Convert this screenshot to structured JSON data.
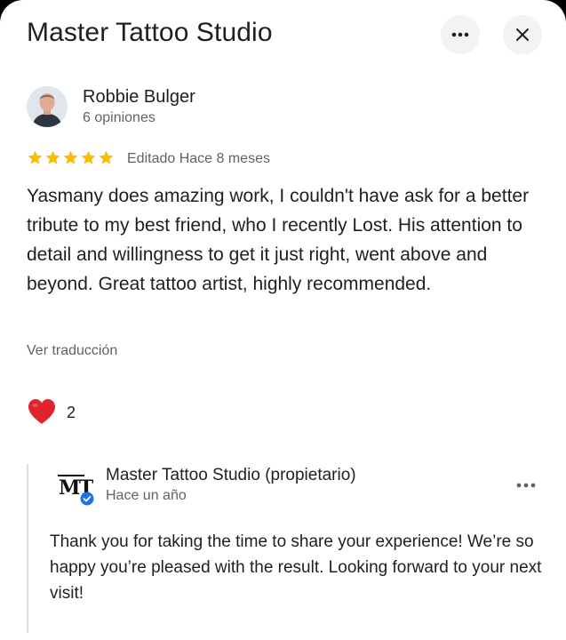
{
  "header": {
    "title": "Master Tattoo Studio",
    "more_icon": "more-horiz-icon",
    "close_icon": "close-icon"
  },
  "review": {
    "reviewer_name": "Robbie Bulger",
    "reviewer_meta": "6 opiniones",
    "rating": 5,
    "rating_max": 5,
    "date": "Editado Hace 8 meses",
    "text": "Yasmany does amazing work, I couldn't have ask for a better tribute to my best friend, who I recently Lost. His attention to detail and willingness to get it just right, went above and beyond. Great tattoo artist, highly recommended.",
    "translate_label": "Ver traducción",
    "reaction_icon": "heart-icon",
    "reaction_count": "2"
  },
  "owner_response": {
    "name": "Master Tattoo Studio (propietario)",
    "time": "Hace un año",
    "logo_text": "MT",
    "text": "Thank you for taking the time to share your experience! We’re so happy you’re pleased with the result. Looking forward to your next visit!"
  },
  "colors": {
    "star": "#fbbc04",
    "heart": "#e0242b",
    "verified": "#1a73e8",
    "secondary_text": "#5f6368"
  }
}
